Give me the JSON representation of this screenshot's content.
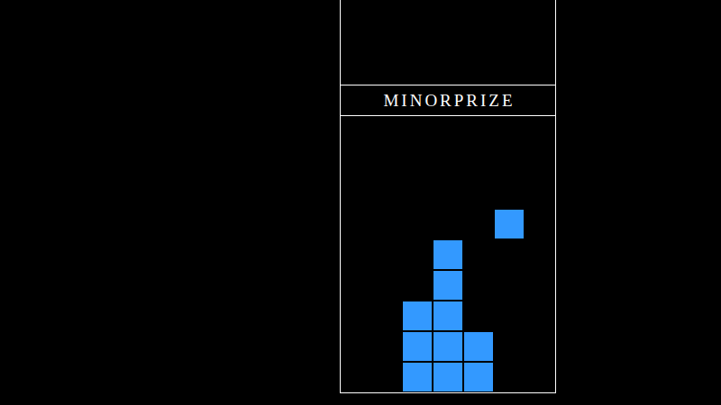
{
  "game": {
    "title": "MINORPRIZE"
  },
  "board": {
    "rows": [
      [
        false,
        false,
        false,
        false,
        false,
        false,
        false
      ],
      [
        false,
        false,
        false,
        false,
        false,
        false,
        false
      ],
      [
        false,
        false,
        false,
        false,
        false,
        false,
        false
      ],
      [
        false,
        false,
        false,
        false,
        false,
        true,
        false
      ],
      [
        false,
        false,
        false,
        true,
        false,
        false,
        false
      ],
      [
        false,
        false,
        false,
        true,
        false,
        false,
        false
      ],
      [
        false,
        false,
        true,
        true,
        false,
        false,
        false
      ],
      [
        false,
        false,
        true,
        true,
        true,
        false,
        false
      ],
      [
        false,
        false,
        true,
        true,
        true,
        false,
        false
      ]
    ]
  }
}
